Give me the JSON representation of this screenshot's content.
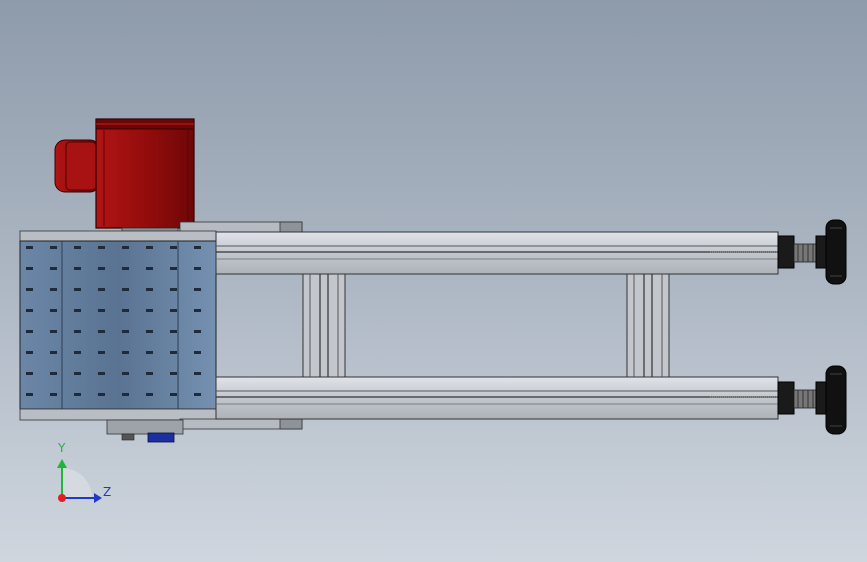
{
  "viewport": {
    "background_top": "#8e9bab",
    "background_bottom": "#cfd6de"
  },
  "model": {
    "motor_color": "#8e0b0b",
    "frame_color": "#c9cdd3",
    "belt_color": "#5f7a9a",
    "knob_color": "#111111",
    "connector_color": "#1c2fa0"
  },
  "triad": {
    "y_label": "Y",
    "z_label": "Z",
    "y_color": "#1fb43a",
    "z_color": "#2438c8",
    "origin_color": "#e02020"
  }
}
